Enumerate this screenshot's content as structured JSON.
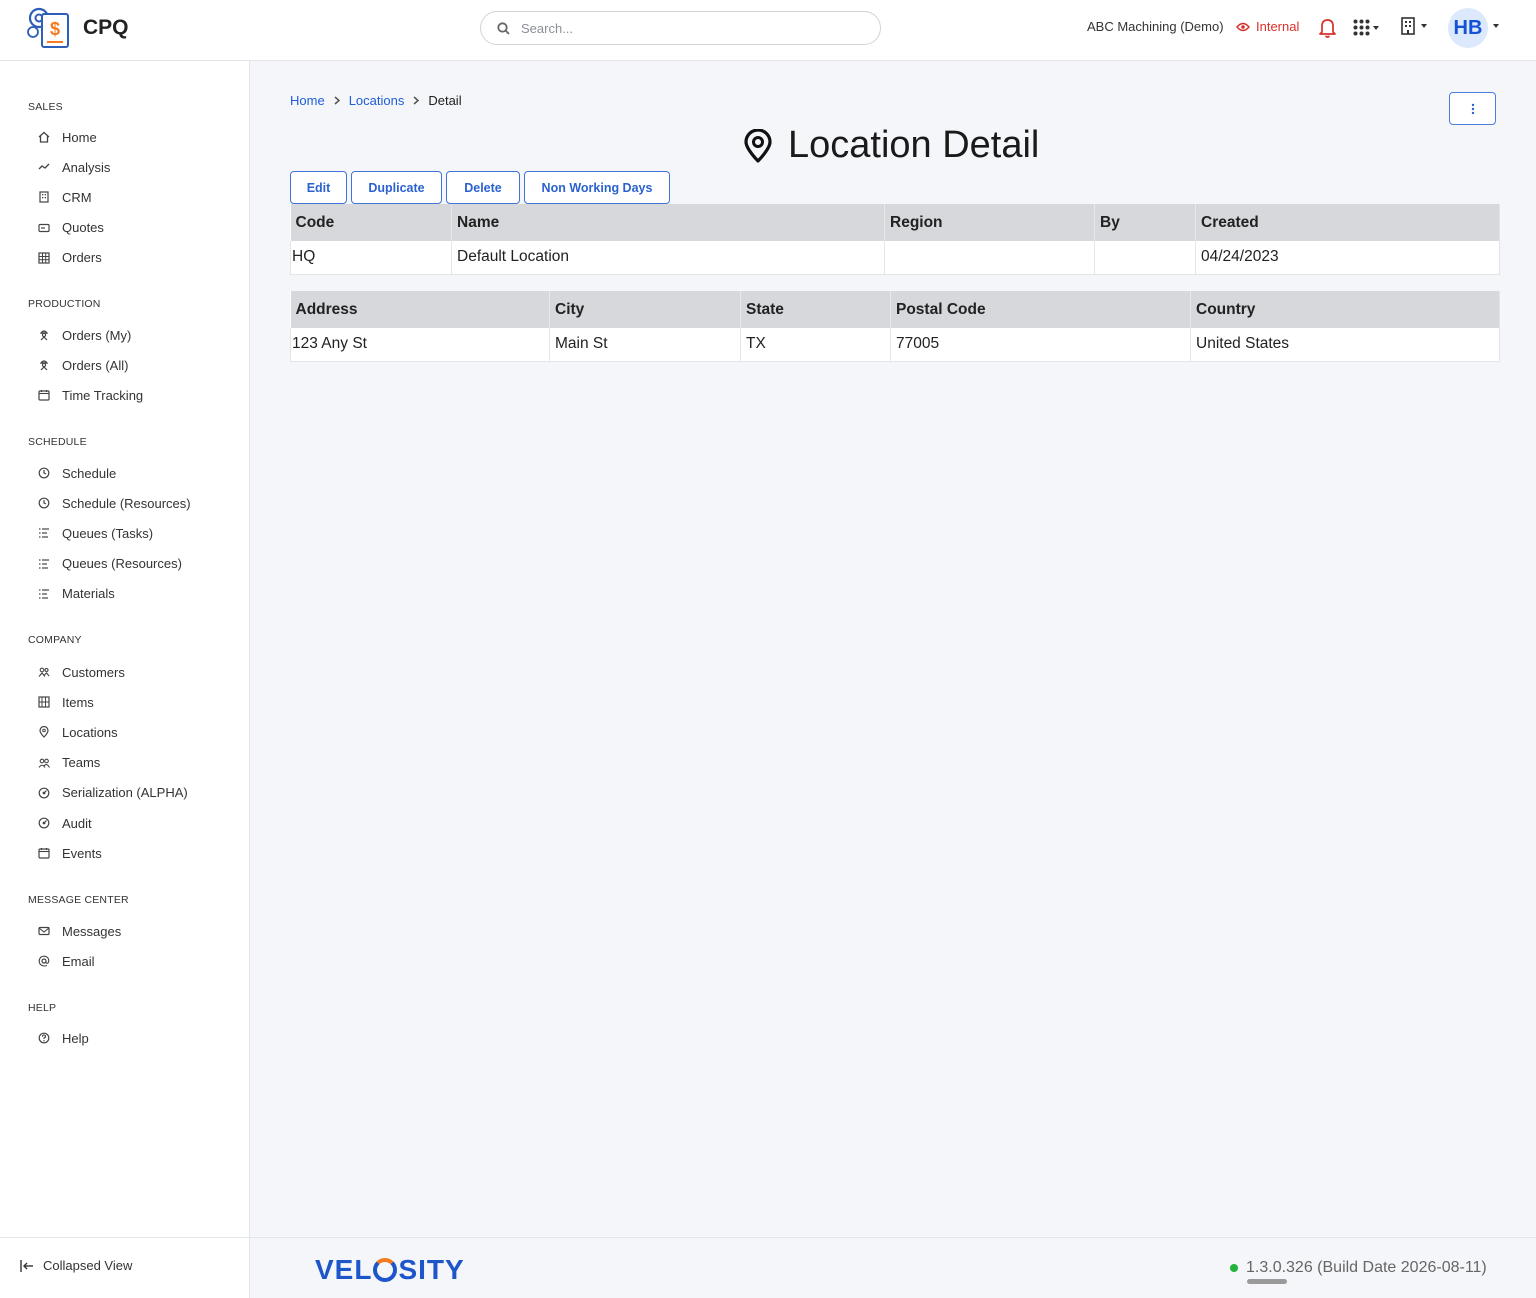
{
  "app": {
    "name": "CPQ"
  },
  "search": {
    "placeholder": "Search..."
  },
  "header": {
    "company": "ABC Machining (Demo)",
    "mode": "Internal",
    "user_initials": "HB"
  },
  "sidebar": {
    "sections": [
      {
        "title": "SALES",
        "items": [
          {
            "label": "Home",
            "icon": "home-icon"
          },
          {
            "label": "Analysis",
            "icon": "trend-icon"
          },
          {
            "label": "CRM",
            "icon": "building-icon"
          },
          {
            "label": "Quotes",
            "icon": "quote-icon"
          },
          {
            "label": "Orders",
            "icon": "grid-icon"
          }
        ]
      },
      {
        "title": "PRODUCTION",
        "items": [
          {
            "label": "Orders (My)",
            "icon": "worker-icon"
          },
          {
            "label": "Orders (All)",
            "icon": "worker-icon"
          },
          {
            "label": "Time Tracking",
            "icon": "calendar-icon"
          }
        ]
      },
      {
        "title": "SCHEDULE",
        "items": [
          {
            "label": "Schedule",
            "icon": "clock-icon"
          },
          {
            "label": "Schedule (Resources)",
            "icon": "clock-icon"
          },
          {
            "label": "Queues (Tasks)",
            "icon": "list-icon"
          },
          {
            "label": "Queues (Resources)",
            "icon": "list-icon"
          },
          {
            "label": "Materials",
            "icon": "list-icon"
          }
        ]
      },
      {
        "title": "COMPANY",
        "items": [
          {
            "label": "Customers",
            "icon": "users-icon"
          },
          {
            "label": "Items",
            "icon": "boxes-icon"
          },
          {
            "label": "Locations",
            "icon": "pin-icon"
          },
          {
            "label": "Teams",
            "icon": "team-icon"
          },
          {
            "label": "Serialization (ALPHA)",
            "icon": "dial-icon"
          },
          {
            "label": "Audit",
            "icon": "dial-icon"
          },
          {
            "label": "Events",
            "icon": "calendar-icon"
          }
        ]
      },
      {
        "title": "MESSAGE CENTER",
        "items": [
          {
            "label": "Messages",
            "icon": "mail-icon"
          },
          {
            "label": "Email",
            "icon": "at-icon"
          }
        ]
      },
      {
        "title": "HELP",
        "items": [
          {
            "label": "Help",
            "icon": "help-icon"
          }
        ]
      }
    ],
    "collapse_label": "Collapsed View"
  },
  "breadcrumb": {
    "home": "Home",
    "locations": "Locations",
    "current": "Detail"
  },
  "page": {
    "title": "Location Detail"
  },
  "actions": {
    "edit": "Edit",
    "duplicate": "Duplicate",
    "delete": "Delete",
    "non_working_days": "Non Working Days"
  },
  "summary_table": {
    "headers": [
      "Code",
      "Name",
      "Region",
      "By",
      "Created"
    ],
    "row": [
      "HQ",
      "Default Location",
      "",
      "",
      "04/24/2023"
    ]
  },
  "address_table": {
    "headers": [
      "Address",
      "City",
      "State",
      "Postal Code",
      "Country"
    ],
    "row": [
      "123 Any St",
      "Main St",
      "TX",
      "77005",
      "United States"
    ]
  },
  "footer": {
    "brand_pre": "VEL",
    "brand_post": "SITY",
    "version": "1.3.0.326 (Build Date 2026-08-11)"
  },
  "colors": {
    "accent": "#1f5ed8",
    "internal": "#d9302a",
    "status_ok": "#22b43a"
  }
}
